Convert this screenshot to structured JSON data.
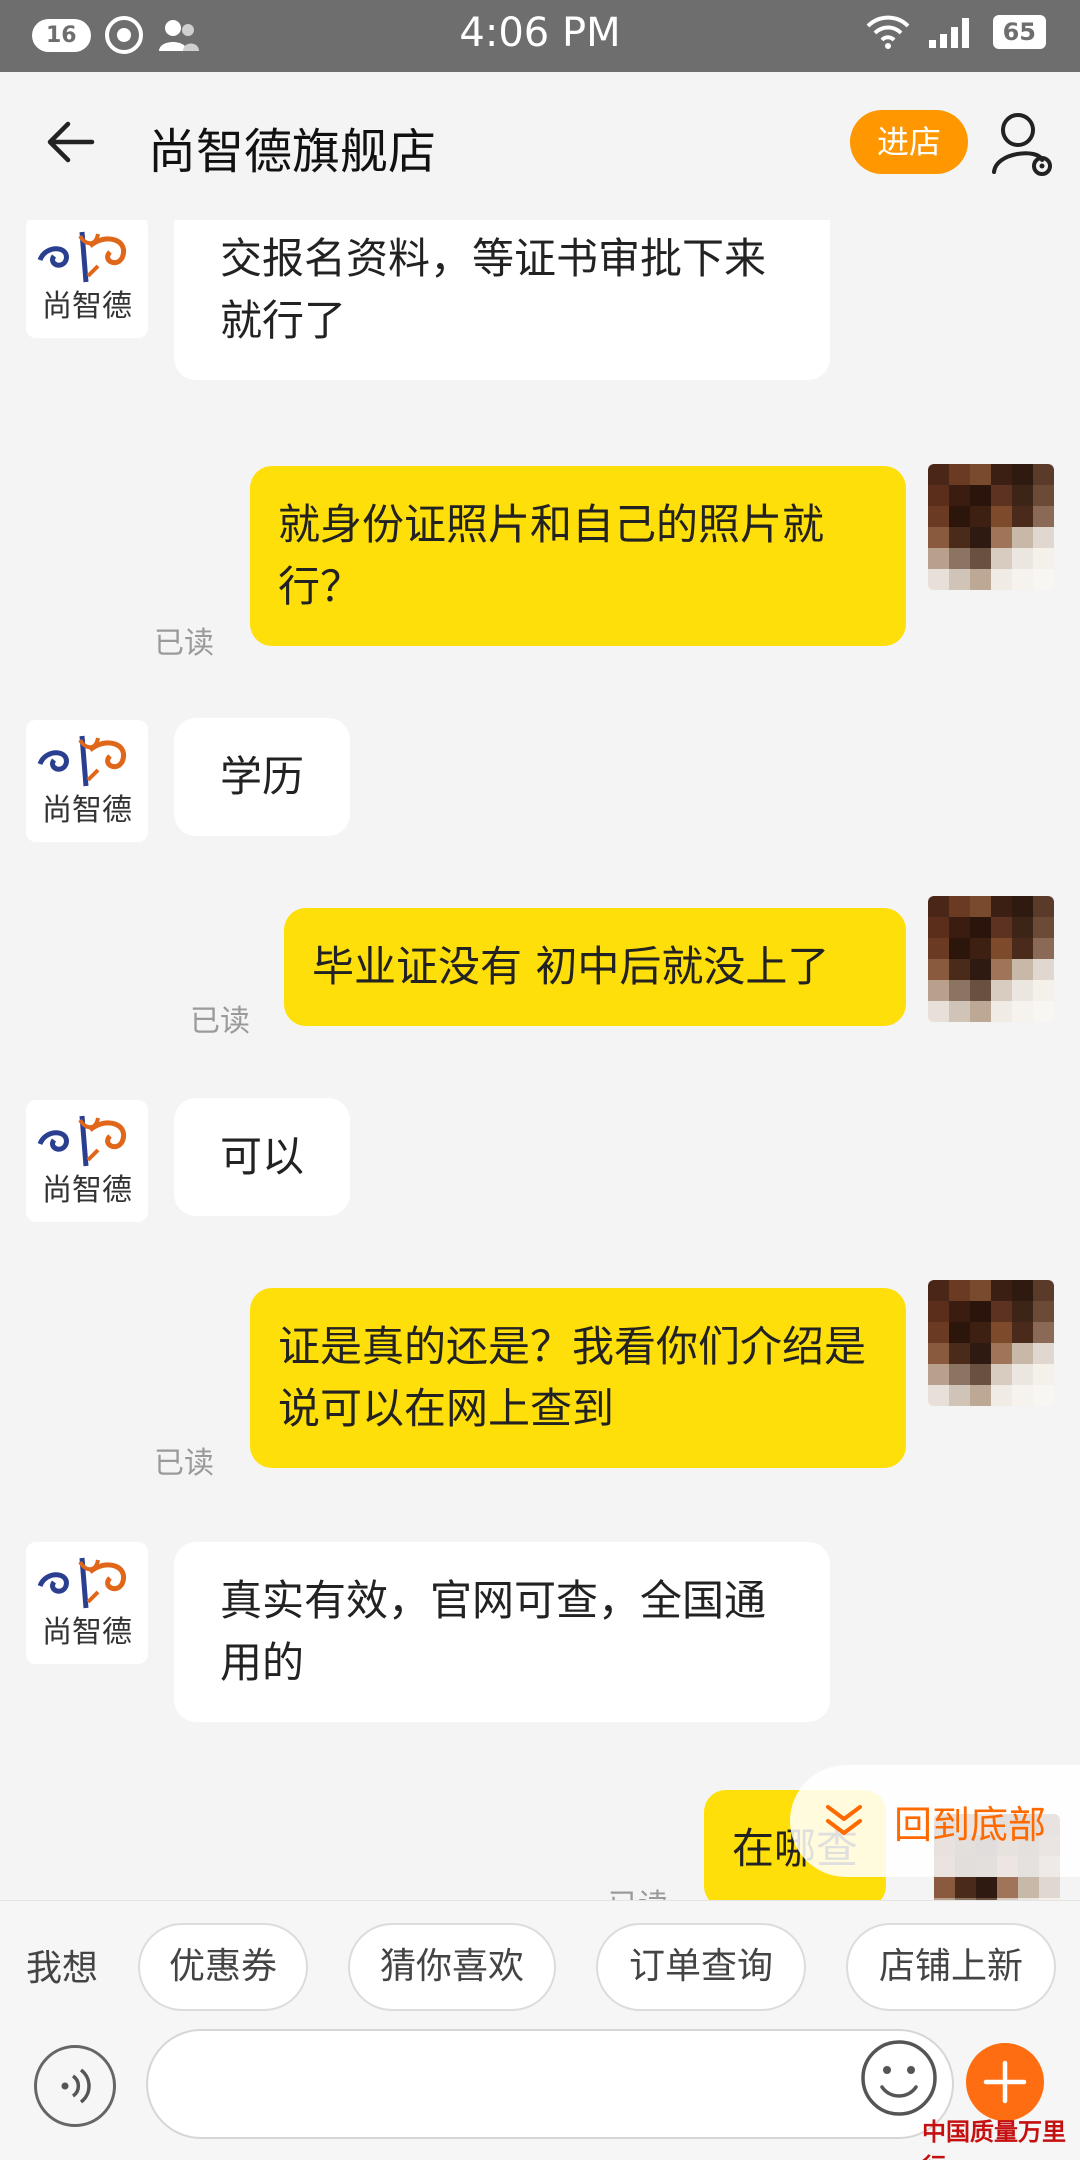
{
  "status_bar": {
    "notification_count": "16",
    "time": "4:06 PM",
    "battery": "65"
  },
  "header": {
    "back_icon": "arrow-left-icon",
    "title": "尚智德旗舰店",
    "enter_store_label": "进店",
    "user_settings_icon": "user-settings-icon"
  },
  "shop_avatar_text": "尚智德",
  "messages": [
    {
      "from": "shop",
      "text": "交报名资料，等证书审批下来就行了"
    },
    {
      "from": "user",
      "text": "就身份证照片和自己的照片就行？",
      "read": "已读"
    },
    {
      "from": "shop",
      "text": "学历"
    },
    {
      "from": "user",
      "text": "毕业证没有 初中后就没上了",
      "read": "已读"
    },
    {
      "from": "shop",
      "text": "可以"
    },
    {
      "from": "user",
      "text": "证是真的还是？我看你们介绍是说可以在网上查到",
      "read": "已读"
    },
    {
      "from": "shop",
      "text": "真实有效，官网可查，全国通用的"
    },
    {
      "from": "user",
      "text": "在哪查",
      "read": "已读"
    }
  ],
  "scroll_to_bottom": {
    "label": "回到底部",
    "icon": "double-chevron-down-icon"
  },
  "quick_replies": {
    "label": "我想",
    "chips": [
      "优惠券",
      "猜你喜欢",
      "订单查询",
      "店铺上新"
    ]
  },
  "composer": {
    "voice_icon": "voice-icon",
    "emoji_icon": "emoji-icon",
    "plus_icon": "plus-icon",
    "input_value": ""
  },
  "watermark": "中国质量万里行",
  "colors": {
    "accent_orange": "#ff9800",
    "user_bubble": "#ffdf0a",
    "link_orange": "#ff6a00",
    "plus_button": "#ff6d12"
  }
}
